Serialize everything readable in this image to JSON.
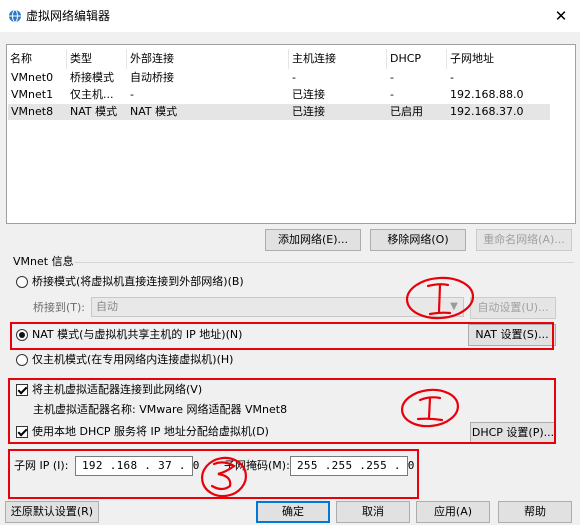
{
  "window": {
    "title": "虚拟网络编辑器",
    "close_glyph": "✕"
  },
  "table": {
    "columns": [
      "名称",
      "类型",
      "外部连接",
      "主机连接",
      "DHCP",
      "子网地址"
    ],
    "rows": [
      {
        "cells": [
          "VMnet0",
          "桥接模式",
          "自动桥接",
          "-",
          "-",
          "-"
        ],
        "selected": false
      },
      {
        "cells": [
          "VMnet1",
          "仅主机...",
          "-",
          "已连接",
          "-",
          "192.168.88.0"
        ],
        "selected": false
      },
      {
        "cells": [
          "VMnet8",
          "NAT 模式",
          "NAT 模式",
          "已连接",
          "已启用",
          "192.168.37.0"
        ],
        "selected": true
      }
    ]
  },
  "table_buttons": {
    "add": "添加网络(E)...",
    "remove": "移除网络(O)",
    "rename": "重命名网络(A)..."
  },
  "vmnet_info": {
    "group_title": "VMnet 信息",
    "bridge_mode": "桥接模式(将虚拟机直接连接到外部网络)(B)",
    "bridge_to_label": "桥接到(T):",
    "bridge_to_value": "自动",
    "auto_settings": "自动设置(U)...",
    "nat_mode": "NAT 模式(与虚拟机共享主机的 IP 地址)(N)",
    "nat_settings": "NAT 设置(S)...",
    "host_only_mode": "仅主机模式(在专用网络内连接虚拟机)(H)",
    "selected_mode": "nat",
    "connect_adapter": "将主机虚拟适配器连接到此网络(V)",
    "connect_adapter_checked": true,
    "adapter_name_line": "主机虚拟适配器名称: VMware 网络适配器 VMnet8",
    "use_dhcp": "使用本地 DHCP 服务将 IP 地址分配给虚拟机(D)",
    "use_dhcp_checked": true,
    "dhcp_settings": "DHCP 设置(P)...",
    "subnet_ip_label": "子网 IP (I):",
    "subnet_ip_value": "192 .168 . 37 . 0",
    "subnet_mask_label": "子网掩码(M):",
    "subnet_mask_value": "255 .255 .255 . 0"
  },
  "footer": {
    "restore": "还原默认设置(R)",
    "ok": "确定",
    "cancel": "取消",
    "apply": "应用(A)",
    "help": "帮助"
  },
  "annotations": {
    "color": "#e8000b",
    "marks": [
      "1",
      "2",
      "3"
    ]
  },
  "colors": {
    "selected_row": "#e5e5e5",
    "primary_border": "#0078d7",
    "annotation_red": "#e8000b"
  }
}
